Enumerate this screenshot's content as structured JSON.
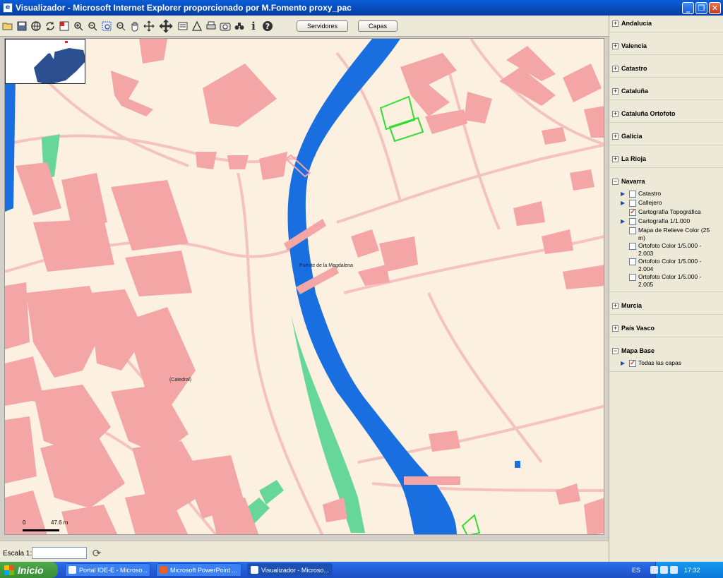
{
  "window": {
    "title": "Visualizador - Microsoft Internet Explorer proporcionado por M.Fomento proxy_pac"
  },
  "toolbar": {
    "tools": [
      "open-icon",
      "save-icon",
      "globe-icon",
      "refresh-icon",
      "zoom-full-icon",
      "zoom-in-icon",
      "zoom-out-icon",
      "zoom-box-icon",
      "zoom-minus-icon",
      "pan-hand-icon",
      "move-icon",
      "pan-arrows-icon",
      "legend-icon",
      "measure-icon",
      "print-icon",
      "camera-icon",
      "binoculars-icon",
      "info-icon",
      "help-icon"
    ],
    "servidores_label": "Servidores",
    "capas_label": "Capas"
  },
  "map": {
    "labels": {
      "bridge": "Puente de la Magdalena",
      "cathedral": "(Catedral)"
    },
    "scale": {
      "zero": "0",
      "distance": "47.6 m"
    }
  },
  "bottom": {
    "scale_label": "Escala 1:",
    "scale_value": ""
  },
  "sidebar": {
    "regions": [
      {
        "name": "Andalucia",
        "expanded": false
      },
      {
        "name": "Valencia",
        "expanded": false
      },
      {
        "name": "Catastro",
        "expanded": false
      },
      {
        "name": "Cataluña",
        "expanded": false
      },
      {
        "name": "Cataluña Ortofoto",
        "expanded": false
      },
      {
        "name": "Galicia",
        "expanded": false
      },
      {
        "name": "La Rioja",
        "expanded": false
      }
    ],
    "navarra": {
      "name": "Navarra",
      "layers": [
        {
          "label": "Catastro",
          "checked": false,
          "arrow": true
        },
        {
          "label": "Callejero",
          "checked": false,
          "arrow": true
        },
        {
          "label": "Cartografía Topográfica",
          "checked": true,
          "arrow": false
        },
        {
          "label": "Cartografía 1/1.000",
          "checked": false,
          "arrow": true
        },
        {
          "label": "Mapa de Relieve Color (25 m)",
          "checked": false,
          "arrow": false
        },
        {
          "label": "Ortofoto Color 1/5.000 - 2.003",
          "checked": false,
          "arrow": false
        },
        {
          "label": "Ortofoto Color 1/5.000 - 2.004",
          "checked": false,
          "arrow": false
        },
        {
          "label": "Ortofoto Color 1/5.000 - 2.005",
          "checked": false,
          "arrow": false
        }
      ]
    },
    "regions_after": [
      {
        "name": "Murcia",
        "expanded": false
      },
      {
        "name": "País Vasco",
        "expanded": false
      }
    ],
    "mapa_base": {
      "name": "Mapa Base",
      "layers": [
        {
          "label": "Todas las capas",
          "checked": true,
          "arrow": true
        }
      ]
    }
  },
  "taskbar": {
    "start_label": "Inicio",
    "tasks": [
      {
        "label": "Portal IDE-E - Microso..."
      },
      {
        "label": "Microsoft PowerPoint ..."
      },
      {
        "label": "Visualizador - Microso..."
      }
    ],
    "tray": {
      "lang": "ES",
      "time": "17:32"
    }
  },
  "colors": {
    "building": "#f4a5a5",
    "river": "#1a6fe0",
    "park": "#66d699",
    "background": "#fcf0e0",
    "street": "#f7c8c8"
  }
}
